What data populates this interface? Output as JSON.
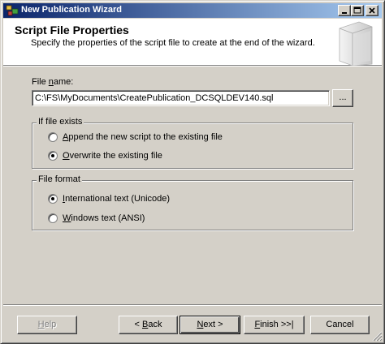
{
  "window": {
    "title": "New Publication Wizard"
  },
  "header": {
    "title": "Script File Properties",
    "subtitle": "Specify the properties of the script file to create at the end of the wizard."
  },
  "file_name": {
    "label_prefix": "File ",
    "label_accel": "n",
    "label_suffix": "ame:",
    "value": "C:\\FS\\MyDocuments\\CreatePublication_DCSQLDEV140.sql",
    "browse_label": "..."
  },
  "if_file_exists": {
    "legend": "If file exists",
    "options": [
      {
        "accel": "A",
        "rest": "ppend the new script to the existing file",
        "selected": false
      },
      {
        "accel": "O",
        "rest": "verwrite the existing file",
        "selected": true
      }
    ]
  },
  "file_format": {
    "legend": "File format",
    "options": [
      {
        "accel": "I",
        "rest": "nternational text (Unicode)",
        "selected": true
      },
      {
        "accel": "W",
        "rest": "indows text (ANSI)",
        "selected": false
      }
    ]
  },
  "buttons": {
    "help": {
      "accel": "H",
      "rest": "elp",
      "enabled": false
    },
    "back": {
      "prefix": "< ",
      "accel": "B",
      "rest": "ack"
    },
    "next": {
      "accel": "N",
      "rest": "ext >"
    },
    "finish": {
      "accel": "F",
      "rest": "inish >>|"
    },
    "cancel": {
      "label": "Cancel"
    }
  },
  "colors": {
    "titlebar_start": "#0a246a",
    "titlebar_end": "#a6caf0",
    "dialog_face": "#d4d0c8",
    "header_bg": "#ffffff"
  },
  "icons": [
    "app-icon",
    "minimize-icon",
    "maximize-icon",
    "close-icon",
    "wizard-graphic",
    "size-grip-icon"
  ]
}
